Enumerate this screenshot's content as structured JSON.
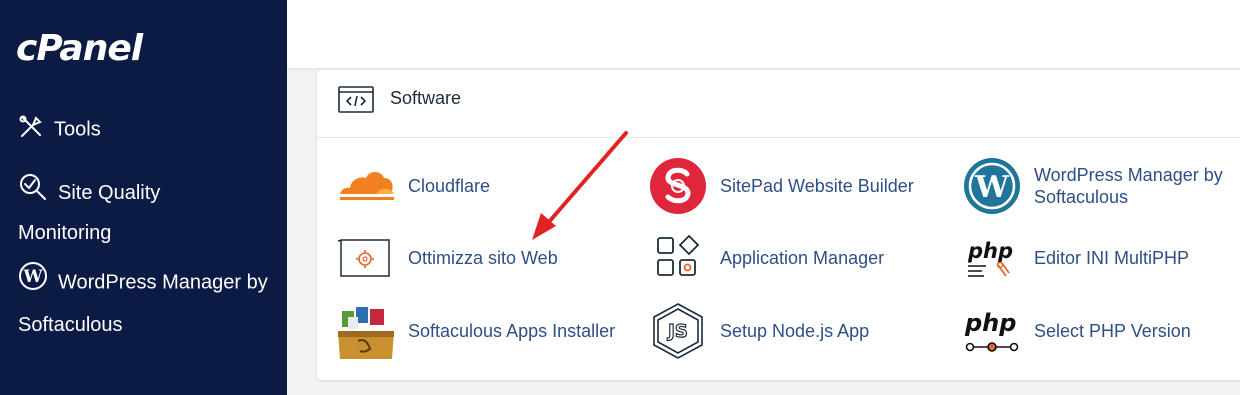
{
  "sidebar": {
    "logo": "cPanel",
    "items": [
      {
        "label": "Tools",
        "icon": "tools-icon"
      },
      {
        "label": "Site Quality Monitoring",
        "icon": "site-quality-icon"
      },
      {
        "label": "WordPress Manager by Softaculous",
        "icon": "wordpress-icon"
      }
    ]
  },
  "section": {
    "title": "Software",
    "icon": "code-window-icon"
  },
  "apps": [
    {
      "label": "Cloudflare",
      "icon": "cloudflare-icon"
    },
    {
      "label": "SitePad Website Builder",
      "icon": "sitepad-icon"
    },
    {
      "label": "WordPress Manager by Softaculous",
      "icon": "wordpress-icon"
    },
    {
      "label": "Ottimizza sito Web",
      "icon": "optimize-website-icon"
    },
    {
      "label": "Application Manager",
      "icon": "application-manager-icon"
    },
    {
      "label": "Editor INI MultiPHP",
      "icon": "php-ini-editor-icon"
    },
    {
      "label": "Softaculous Apps Installer",
      "icon": "softaculous-icon"
    },
    {
      "label": "Setup Node.js App",
      "icon": "nodejs-icon"
    },
    {
      "label": "Select PHP Version",
      "icon": "select-php-icon"
    }
  ],
  "colors": {
    "sidebar_bg": "#0c1b43",
    "link": "#2e4f86",
    "annotation_arrow": "#e02424",
    "cloudflare": "#f38020",
    "sitepad": "#e0263b",
    "wordpress": "#21759b"
  }
}
